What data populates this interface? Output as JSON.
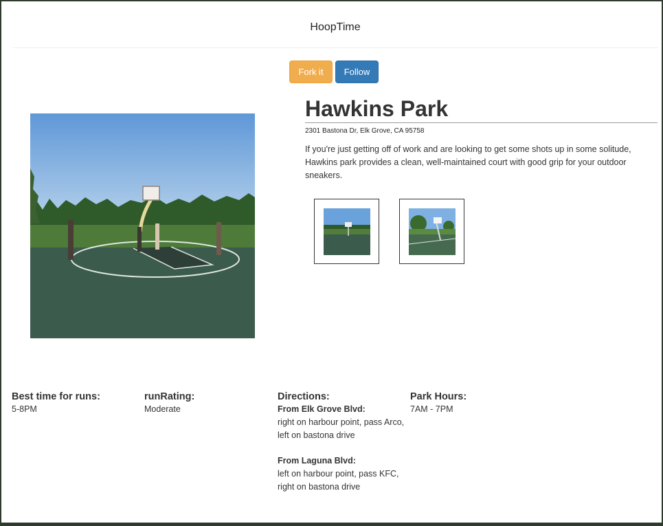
{
  "navbar": {
    "brand": "HoopTime"
  },
  "actions": {
    "fork_label": "Fork it",
    "follow_label": "Follow"
  },
  "park": {
    "name": "Hawkins Park",
    "address": "2301 Bastona Dr, Elk Grove, CA 95758",
    "description": "If you're just getting off of work and are looking to get some shots up in some solitude, Hawkins park provides a clean, well-maintained court with good grip for your outdoor sneakers."
  },
  "info": {
    "best_time": {
      "label": "Best time for runs:",
      "value": "5-8PM"
    },
    "run_rating": {
      "label": "runRating:",
      "value": "Moderate"
    },
    "directions": {
      "label": "Directions:",
      "routes": [
        {
          "from": "From Elk Grove Blvd:",
          "text": "right on harbour point, pass Arco, left on bastona drive"
        },
        {
          "from": "From Laguna Blvd:",
          "text": "left on harbour point, pass KFC, right on bastona drive"
        }
      ]
    },
    "park_hours": {
      "label": "Park Hours:",
      "value": "7AM - 7PM"
    }
  }
}
